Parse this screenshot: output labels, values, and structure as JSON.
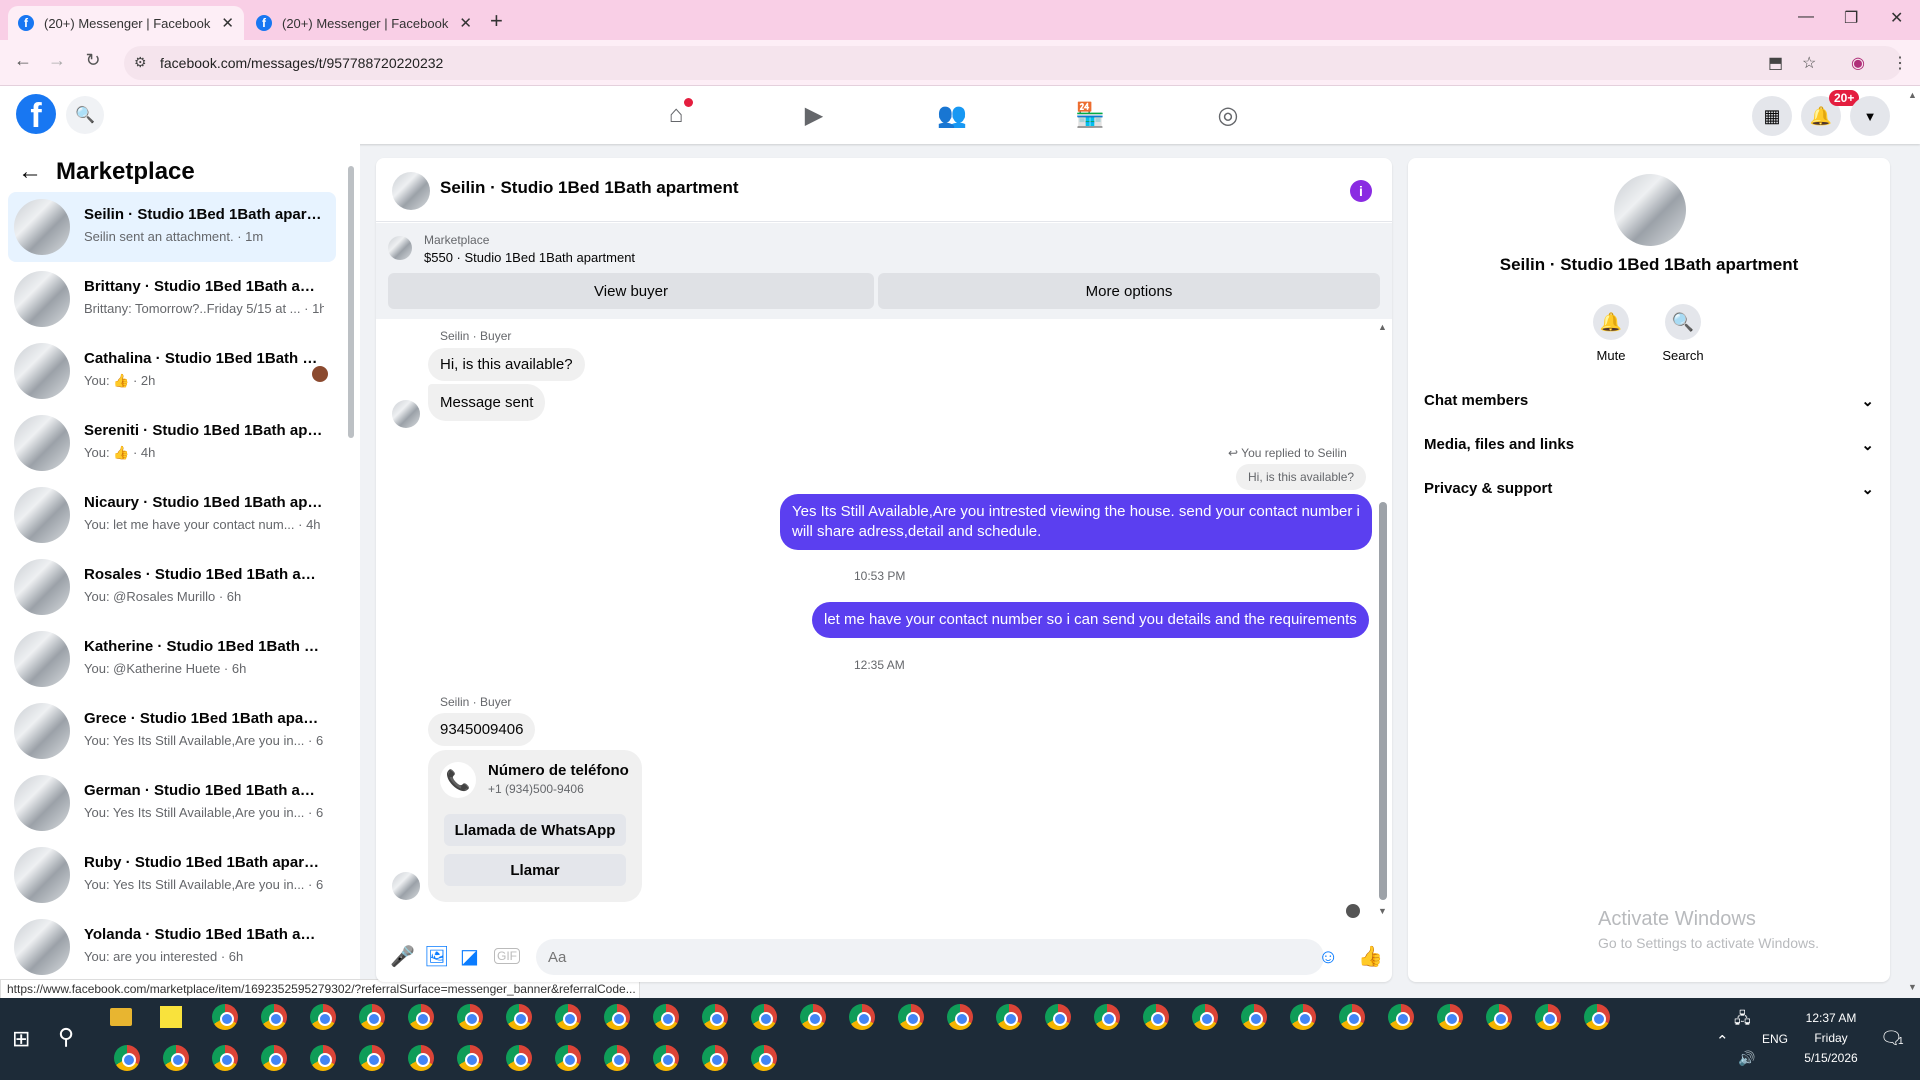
{
  "browser": {
    "tabs": [
      {
        "title": "(20+) Messenger | Facebook",
        "active": true
      },
      {
        "title": "(20+) Messenger | Facebook",
        "active": false
      }
    ],
    "url": "facebook.com/messages/t/957788720220232",
    "status_url": "https://www.facebook.com/marketplace/item/1692352595279302/?referralSurface=messenger_banner&referralCode..."
  },
  "fbnav": {
    "notif_badge": "20+",
    "icons": [
      "home-icon",
      "video-icon",
      "friends-icon",
      "marketplace-icon",
      "groups-icon"
    ]
  },
  "sidebar": {
    "title": "Marketplace",
    "conversations": [
      {
        "name": "Seilin · Studio 1Bed 1Bath apartment",
        "preview": "Seilin sent an attachment. · 1m",
        "selected": true
      },
      {
        "name": "Brittany · Studio 1Bed 1Bath apartment",
        "preview": "Brittany: Tomorrow?..Friday 5/15 at ... · 1h"
      },
      {
        "name": "Cathalina · Studio 1Bed 1Bath apartment",
        "preview": "You: 👍 · 2h",
        "seen": true
      },
      {
        "name": "Sereniti · Studio 1Bed 1Bath apartment",
        "preview": "You: 👍 · 4h"
      },
      {
        "name": "Nicaury · Studio 1Bed 1Bath apartment",
        "preview": "You: let me have your contact num... · 4h"
      },
      {
        "name": "Rosales · Studio 1Bed 1Bath apartment",
        "preview": "You: @Rosales Murillo · 6h"
      },
      {
        "name": "Katherine · Studio 1Bed 1Bath apartment",
        "preview": "You: @Katherine Huete · 6h"
      },
      {
        "name": "Grece · Studio 1Bed 1Bath apartment",
        "preview": "You: Yes Its Still Available,Are you in... · 6h"
      },
      {
        "name": "German · Studio 1Bed 1Bath apartment",
        "preview": "You: Yes Its Still Available,Are you in... · 6h"
      },
      {
        "name": "Ruby · Studio 1Bed 1Bath apartment",
        "preview": "You: Yes Its Still Available,Are you in... · 6h"
      },
      {
        "name": "Yolanda · Studio 1Bed 1Bath apartment",
        "preview": "You: are you interested · 6h"
      }
    ]
  },
  "chat": {
    "title": "Seilin · Studio 1Bed 1Bath apartment",
    "banner": {
      "label": "Marketplace",
      "item": "$550 · Studio 1Bed 1Bath apartment",
      "view_buyer": "View buyer",
      "more_options": "More options"
    },
    "messages": {
      "sender1": "Seilin · Buyer",
      "in1": "Hi, is this available?",
      "in2": "Message sent",
      "replied_to": "You replied to Seilin",
      "reply_quote": "Hi, is this available?",
      "out1": "Yes Its Still Available,Are you intrested viewing the house. send your contact number i will share adress,detail and schedule.",
      "ts1": "10:53 PM",
      "out2": "let me have your contact number so i can send you details and the requirements",
      "ts2": "12:35 AM",
      "sender2": "Seilin · Buyer",
      "in3": "9345009406",
      "phone_title": "Número de teléfono",
      "phone_number": "+1 (934)500-9406",
      "whatsapp_btn": "Llamada de WhatsApp",
      "call_btn": "Llamar"
    },
    "composer_placeholder": "Aa"
  },
  "details": {
    "name": "Seilin · Studio 1Bed 1Bath apartment",
    "mute": "Mute",
    "search": "Search",
    "sections": [
      "Chat members",
      "Media, files and links",
      "Privacy & support"
    ]
  },
  "watermark": {
    "line1": "Activate Windows",
    "line2": "Go to Settings to activate Windows."
  },
  "taskbar": {
    "lang": "ENG",
    "time": "12:37 AM",
    "day": "Friday",
    "date": "5/15/2026",
    "notif": "1"
  }
}
